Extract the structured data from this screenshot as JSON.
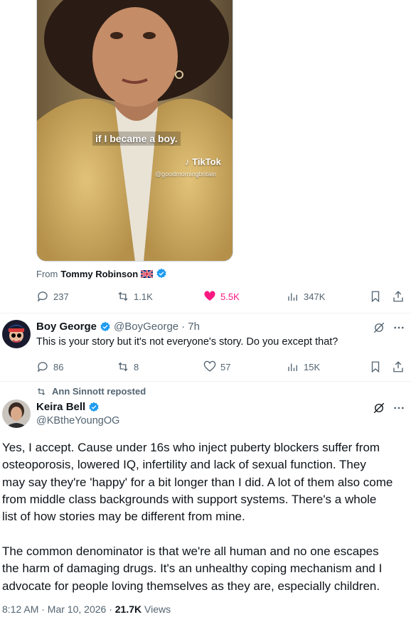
{
  "video": {
    "caption": "if I became a boy.",
    "watermark_brand": "TikTok",
    "watermark_handle": "@goodmorningbritain"
  },
  "quoted_post": {
    "from_label": "From",
    "author": "Tommy Robinson",
    "metrics": {
      "replies": "237",
      "reposts": "1.1K",
      "likes": "5.5K",
      "views": "347K"
    }
  },
  "reply": {
    "name": "Boy George",
    "handle": "@BoyGeorge",
    "time": "· 7h",
    "text": "This is your story but it's not everyone's story. Do you except that?",
    "metrics": {
      "replies": "86",
      "reposts": "8",
      "likes": "57",
      "views": "15K"
    }
  },
  "main_post": {
    "repost_label": "Ann Sinnott reposted",
    "name": "Keira Bell",
    "handle": "@KBtheYoungOG",
    "paragraph1": [
      "Yes, I accept. Cause under 16s who inject puberty blockers suffer from",
      "osteoporosis, lowered IQ, infertility and lack of sexual function. They",
      "may say they're 'happy' for a bit longer than I did. A lot of them also come",
      "from middle class backgrounds with support systems. There's a whole",
      "list of how stories may be different from mine."
    ],
    "paragraph2": [
      "The common denominator is that we're all human and no one escapes",
      "the harm of damaging drugs. It's an unhealthy coping mechanism and I",
      "advocate for people loving themselves as they are, especially children."
    ],
    "timestamp": "8:12 AM · Mar 10, 2026 · ",
    "views_count": "21.7K",
    "views_label": " Views"
  },
  "colors": {
    "accent_blue": "#1d9bf0",
    "like_pink": "#f91880",
    "muted": "#536471"
  }
}
